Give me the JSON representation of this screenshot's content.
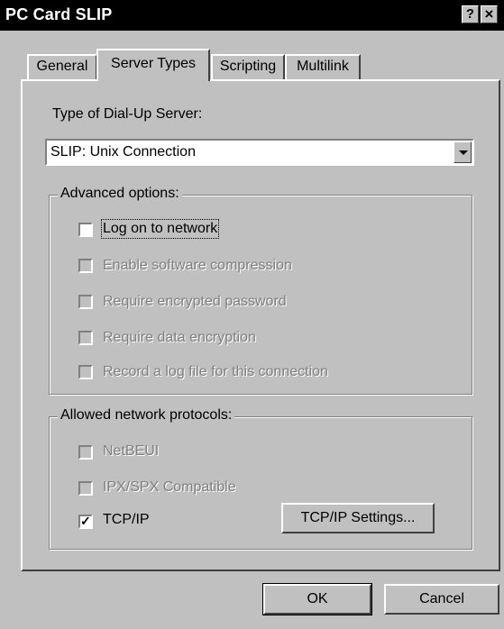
{
  "window": {
    "title": "PC Card SLIP"
  },
  "titlebar_buttons": {
    "help": "?",
    "close": "×"
  },
  "tabs": [
    {
      "label": "General",
      "active": false
    },
    {
      "label": "Server Types",
      "active": true
    },
    {
      "label": "Scripting",
      "active": false
    },
    {
      "label": "Multilink",
      "active": false
    }
  ],
  "server_type": {
    "label": "Type of Dial-Up Server:",
    "selected": "SLIP: Unix Connection"
  },
  "advanced": {
    "title": "Advanced options:",
    "options": [
      {
        "label": "Log on to network",
        "checked": false,
        "enabled": true
      },
      {
        "label": "Enable software compression",
        "checked": false,
        "enabled": false
      },
      {
        "label": "Require encrypted password",
        "checked": false,
        "enabled": false
      },
      {
        "label": "Require data encryption",
        "checked": false,
        "enabled": false
      },
      {
        "label": "Record a log file for this connection",
        "checked": false,
        "enabled": false
      }
    ]
  },
  "protocols": {
    "title": "Allowed network protocols:",
    "options": [
      {
        "label": "NetBEUI",
        "checked": false,
        "enabled": false
      },
      {
        "label": "IPX/SPX Compatible",
        "checked": false,
        "enabled": false
      },
      {
        "label": "TCP/IP",
        "checked": true,
        "enabled": true
      }
    ],
    "settings_button": "TCP/IP Settings..."
  },
  "footer": {
    "ok": "OK",
    "cancel": "Cancel"
  }
}
